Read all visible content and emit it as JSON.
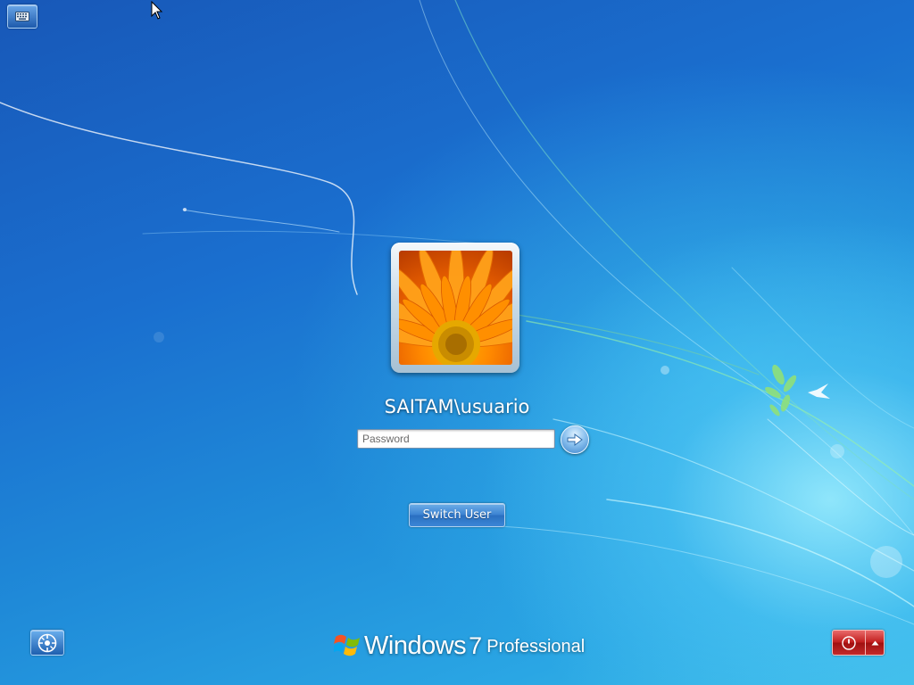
{
  "logon": {
    "username": "SAITAM\\usuario",
    "password_placeholder": "Password",
    "password_value": "",
    "switch_user_label": "Switch User"
  },
  "branding": {
    "windows": "Windows",
    "version": "7",
    "edition": "Professional"
  },
  "icons": {
    "keyboard": "keyboard-icon",
    "ease_of_access": "ease-of-access-icon",
    "submit": "arrow-right-icon",
    "shutdown": "power-icon",
    "shutdown_menu": "triangle-up-icon",
    "windows_logo": "windows-flag-icon"
  },
  "colors": {
    "background_primary": "#1a6fcf",
    "background_glow": "#a0f0ff",
    "shutdown_red": "#c21f1f",
    "button_blue": "#3c83d2"
  }
}
